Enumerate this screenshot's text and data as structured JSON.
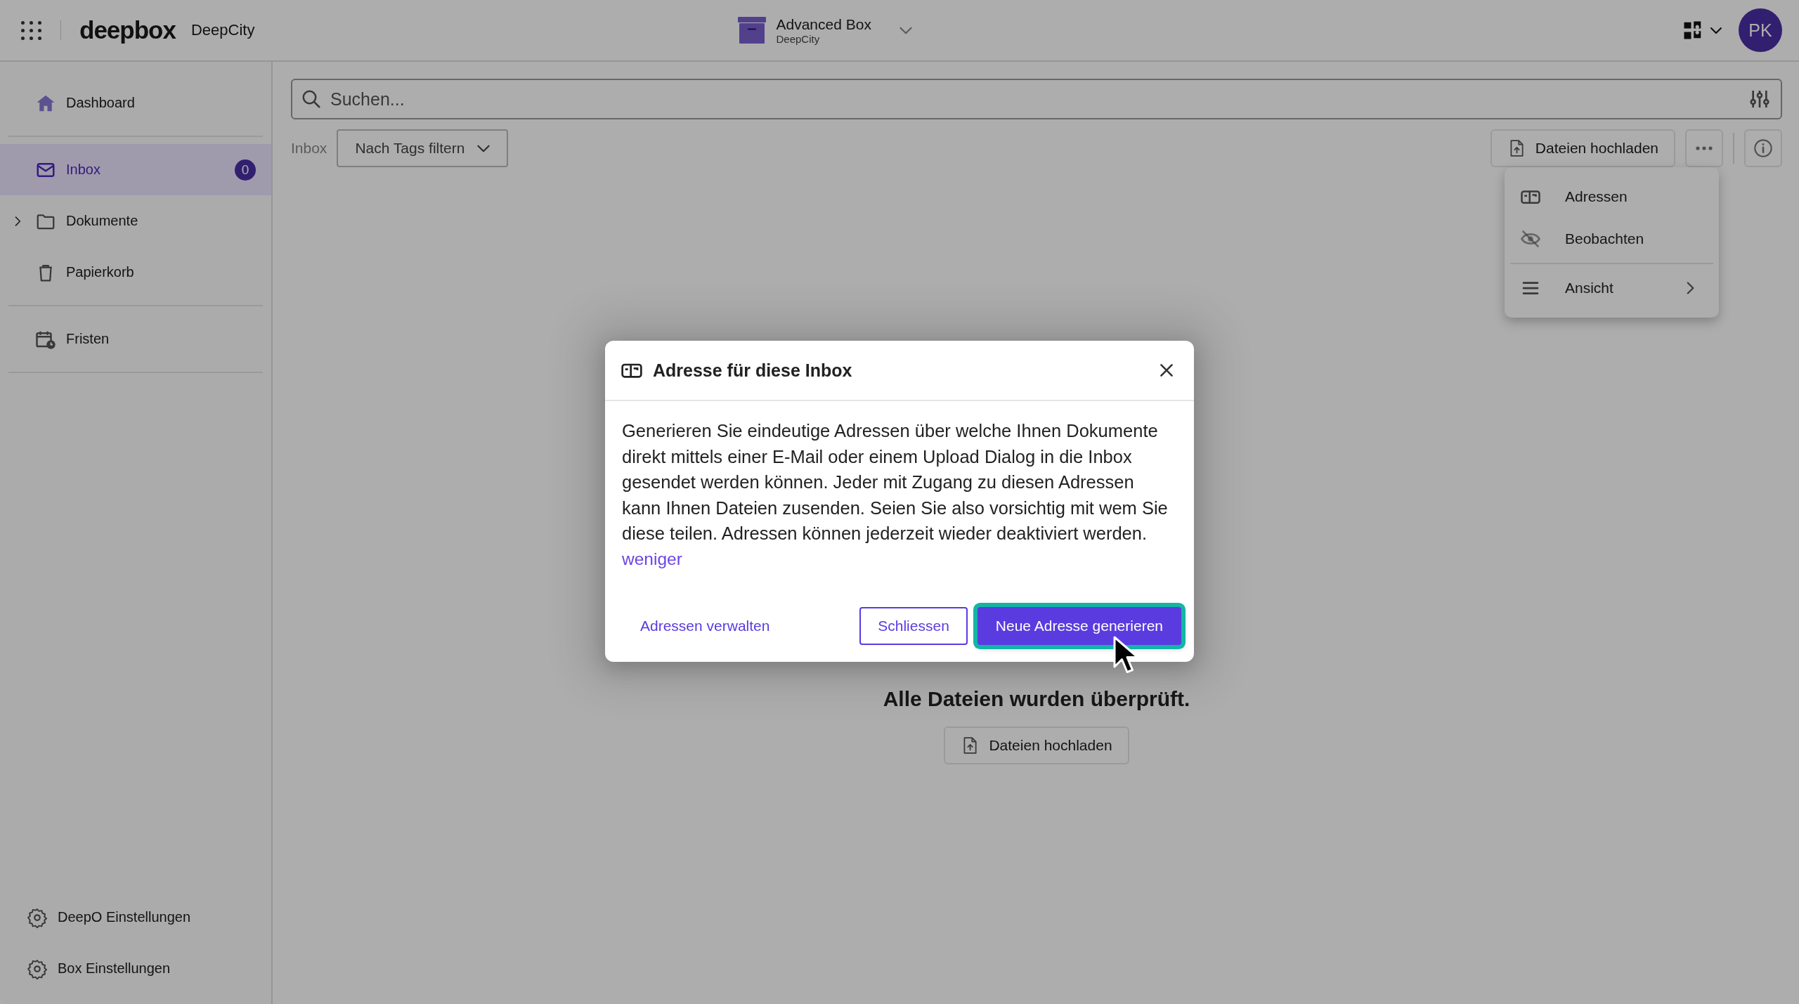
{
  "app_bar": {
    "logo": "deepbox",
    "org": "DeepCity",
    "box": {
      "name": "Advanced Box",
      "org": "DeepCity"
    },
    "avatar": "PK"
  },
  "sidebar": {
    "sections": [
      [
        {
          "label": "Dashboard",
          "selected": false
        }
      ],
      [
        {
          "label": "Inbox",
          "selected": true,
          "badge": "0"
        },
        {
          "label": "Dokumente",
          "selected": false,
          "expanded": false
        },
        {
          "label": "Papierkorb",
          "selected": false
        }
      ],
      [
        {
          "label": "Fristen",
          "selected": false
        }
      ]
    ],
    "footer": [
      {
        "label": "DeepO Einstellungen"
      },
      {
        "label": "Box Einstellungen"
      }
    ]
  },
  "search": {
    "placeholder": "Suchen..."
  },
  "toolbar": {
    "breadcrumb": "Inbox",
    "tag_filter": "Nach Tags filtern",
    "upload_button": "Dateien hochladen"
  },
  "more_menu": {
    "sections": [
      [
        {
          "label": "Adressen",
          "submenu": false
        },
        {
          "label": "Beobachten",
          "submenu": false
        }
      ],
      [
        {
          "label": "Ansicht",
          "submenu": true
        }
      ]
    ]
  },
  "empty_state": {
    "title": "Alle Dateien wurden überprüft.",
    "button": "Dateien hochladen"
  },
  "dialog": {
    "title": "Adresse für diese Inbox",
    "body": "Generieren Sie eindeutige Adressen über welche Ihnen Dokumente direkt mittels einer E-Mail oder einem Upload Dialog in die Inbox gesendet werden können. Jeder mit Zugang zu diesen Adressen kann Ihnen Dateien zusenden. Seien Sie also vorsichtig mit wem Sie diese teilen. Adressen können jederzeit wieder deaktiviert werden.",
    "link": "weniger",
    "buttons": [
      {
        "label": "Adressen verwalten",
        "kind": "text",
        "focused": false
      },
      {
        "label": "Schliessen",
        "kind": "outline",
        "focused": false
      },
      {
        "label": "Neue Adresse generieren",
        "kind": "primary",
        "focused": true
      }
    ]
  }
}
